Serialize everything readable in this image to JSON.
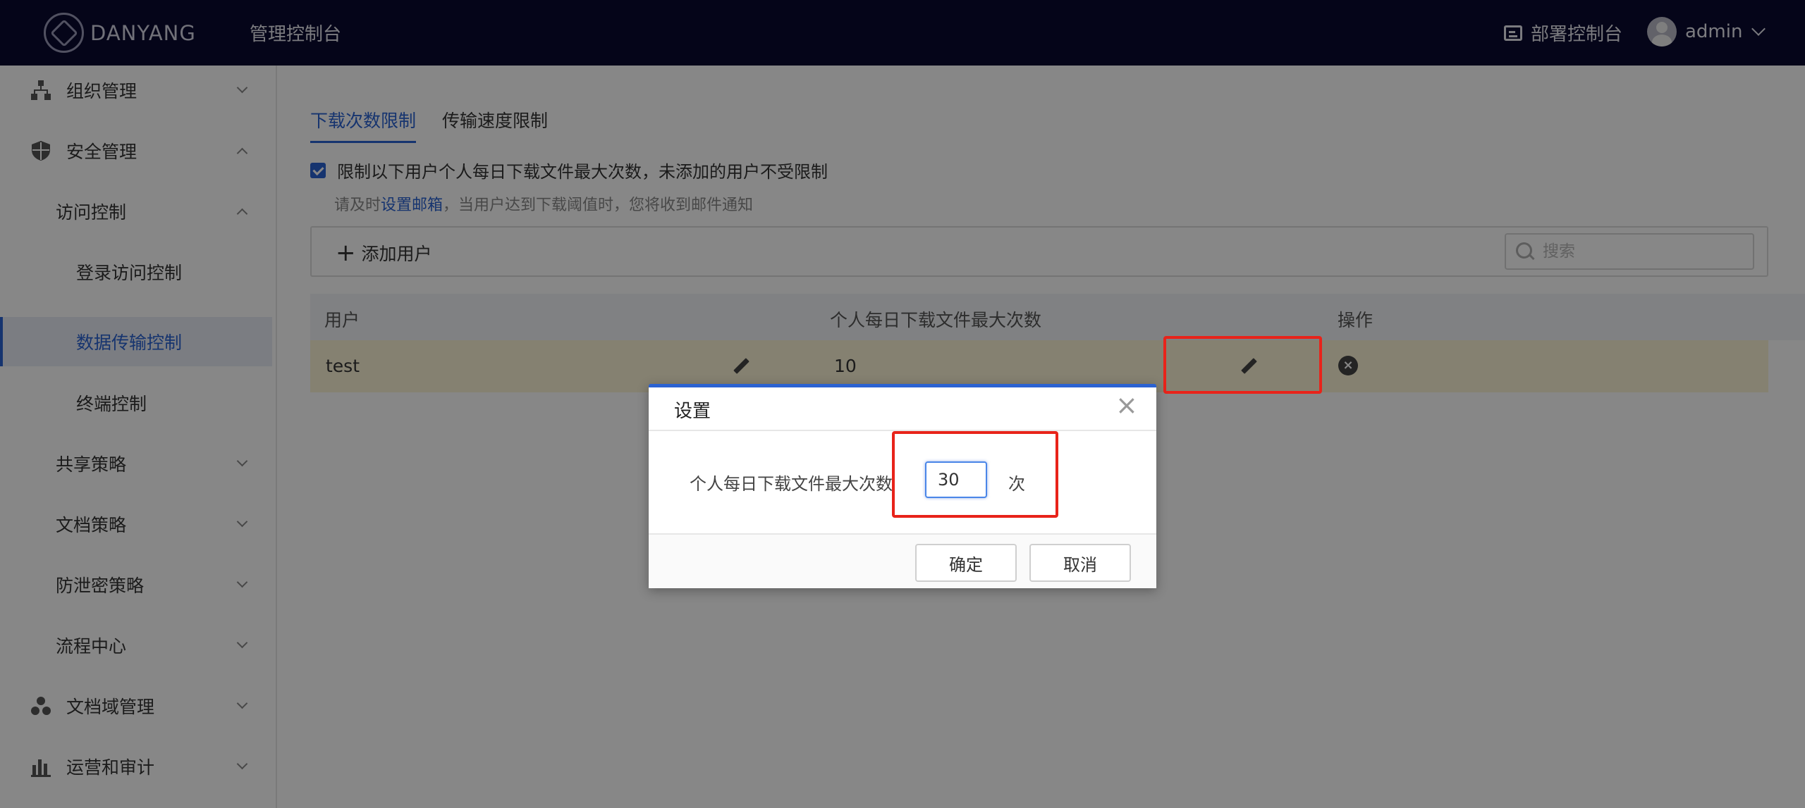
{
  "header": {
    "brand": "DANYANG",
    "app_title": "管理控制台",
    "deploy_label": "部署控制台",
    "username": "admin"
  },
  "sidebar": {
    "items": [
      {
        "label": "组织管理",
        "icon": "org-tree-icon",
        "expanded": false
      },
      {
        "label": "安全管理",
        "icon": "shield-icon",
        "expanded": true
      },
      {
        "label": "访问控制",
        "expanded": true
      },
      {
        "label": "登录访问控制"
      },
      {
        "label": "数据传输控制",
        "active": true
      },
      {
        "label": "终端控制"
      },
      {
        "label": "共享策略",
        "expanded": false
      },
      {
        "label": "文档策略",
        "expanded": false
      },
      {
        "label": "防泄密策略",
        "expanded": false
      },
      {
        "label": "流程中心",
        "expanded": false
      },
      {
        "label": "文档域管理",
        "icon": "cluster-icon",
        "expanded": false
      },
      {
        "label": "运营和审计",
        "icon": "bar-chart-icon",
        "expanded": false
      }
    ]
  },
  "tabs": [
    {
      "label": "下载次数限制",
      "active": true
    },
    {
      "label": "传输速度限制",
      "active": false
    }
  ],
  "restriction": {
    "checked": true,
    "text": "限制以下用户个人每日下载文件最大次数，未添加的用户不受限制",
    "hint_prefix": "请及时",
    "hint_link": "设置邮箱",
    "hint_suffix": "，当用户达到下载阈值时，您将收到邮件通知"
  },
  "toolbar": {
    "add_user_label": "添加用户",
    "search_placeholder": "搜索"
  },
  "table": {
    "columns": [
      "用户",
      "个人每日下载文件最大次数",
      "操作"
    ],
    "rows": [
      {
        "user": "test",
        "max_downloads": "10"
      }
    ]
  },
  "dialog": {
    "title": "设置",
    "field_label": "个人每日下载文件最大次数",
    "value": "30",
    "unit": "次",
    "confirm_label": "确定",
    "cancel_label": "取消"
  },
  "colors": {
    "header_bg": "#0b0b30",
    "accent": "#2b62d2",
    "highlight": "#e8231a",
    "row_highlight": "#fcf3d6"
  }
}
